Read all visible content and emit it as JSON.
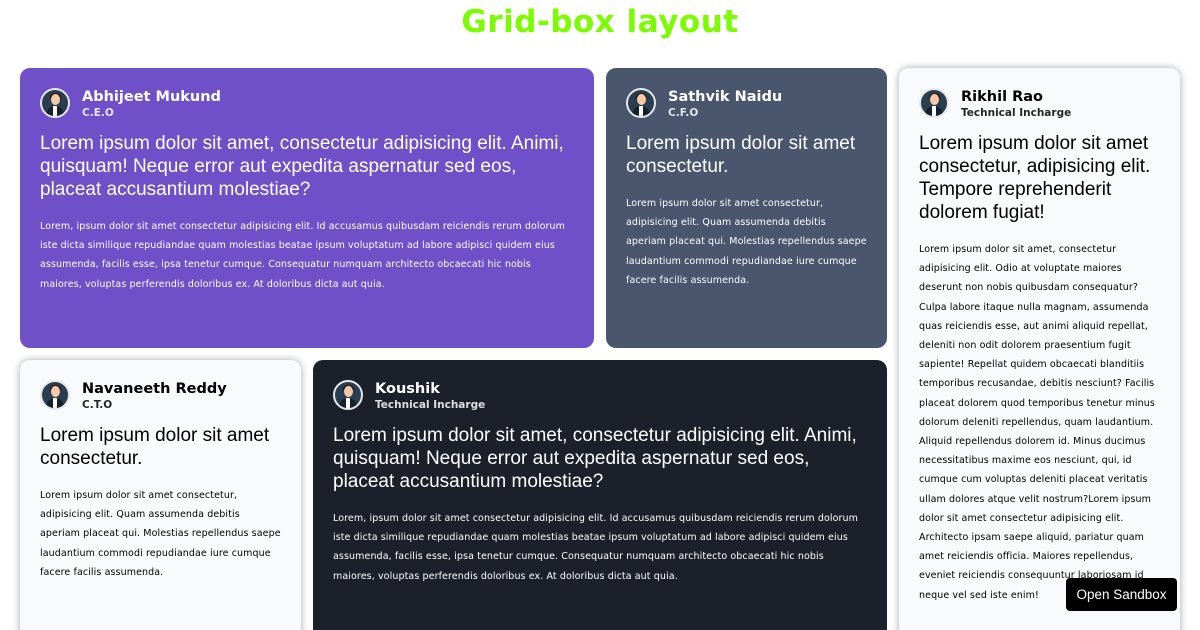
{
  "page_title": "Grid-box layout",
  "sandbox_button": "Open Sandbox",
  "cards": [
    {
      "name": "Abhijeet Mukund",
      "role": "C.E.O",
      "lead": "Lorem ipsum dolor sit amet, consectetur adipisicing elit. Animi, quisquam! Neque error aut expedita aspernatur sed eos, placeat accusantium molestiae?",
      "body": "Lorem, ipsum dolor sit amet consectetur adipisicing elit. Id accusamus quibusdam reiciendis rerum dolorum iste dicta similique repudiandae quam molestias beatae ipsum voluptatum ad labore adipisci quidem eius assumenda, facilis esse, ipsa tenetur cumque. Consequatur numquam architecto obcaecati hic nobis maiores, voluptas perferendis doloribus ex. At doloribus dicta aut quia.",
      "bg": "#7050c8"
    },
    {
      "name": "Sathvik Naidu",
      "role": "C.F.O",
      "lead": "Lorem ipsum dolor sit amet consectetur.",
      "body": "Lorem ipsum dolor sit amet consectetur, adipisicing elit. Quam assumenda debitis aperiam placeat qui. Molestias repellendus saepe laudantium commodi repudiandae iure cumque facere facilis assumenda.",
      "bg": "#4a566e"
    },
    {
      "name": "Rikhil Rao",
      "role": "Technical Incharge",
      "lead": "Lorem ipsum dolor sit amet consectetur, adipisicing elit. Tempore reprehenderit dolorem fugiat!",
      "body": "Lorem ipsum dolor sit amet, consectetur adipisicing elit. Odio at voluptate maiores deserunt non nobis quibusdam consequatur? Culpa labore itaque nulla magnam, assumenda quas reiciendis esse, aut animi aliquid repellat, deleniti non odit dolorem praesentium fugit sapiente! Repellat quidem obcaecati blanditiis temporibus recusandae, debitis nesciunt? Facilis placeat dolorem quod temporibus tenetur minus dolorum deleniti repellendus, quam laudantium. Aliquid repellendus dolorem id. Minus ducimus necessitatibus maxime eos nesciunt, qui, id cumque cum voluptas deleniti placeat veritatis ullam dolores atque velit nostrum?Lorem ipsum dolor sit amet consectetur adipisicing elit. Architecto ipsam saepe aliquid, pariatur quam amet reiciendis officia. Maiores repellendus, eveniet reiciendis consequuntur laboriosam id neque vel sed iste enim!",
      "bg": "#f8fafc"
    },
    {
      "name": "Navaneeth Reddy",
      "role": "C.T.O",
      "lead": "Lorem ipsum dolor sit amet consectetur.",
      "body": "Lorem ipsum dolor sit amet consectetur, adipisicing elit. Quam assumenda debitis aperiam placeat qui. Molestias repellendus saepe laudantium commodi repudiandae iure cumque facere facilis assumenda.",
      "bg": "#f8fafc"
    },
    {
      "name": "Koushik",
      "role": "Technical Incharge",
      "lead": "Lorem ipsum dolor sit amet, consectetur adipisicing elit. Animi, quisquam! Neque error aut expedita aspernatur sed eos, placeat accusantium molestiae?",
      "body": "Lorem, ipsum dolor sit amet consectetur adipisicing elit. Id accusamus quibusdam reiciendis rerum dolorum iste dicta similique repudiandae quam molestias beatae ipsum voluptatum ad labore adipisci quidem eius assumenda, facilis esse, ipsa tenetur cumque. Consequatur numquam architecto obcaecati hic nobis maiores, voluptas perferendis doloribus ex. At doloribus dicta aut quia.",
      "bg": "#1c202a"
    }
  ]
}
